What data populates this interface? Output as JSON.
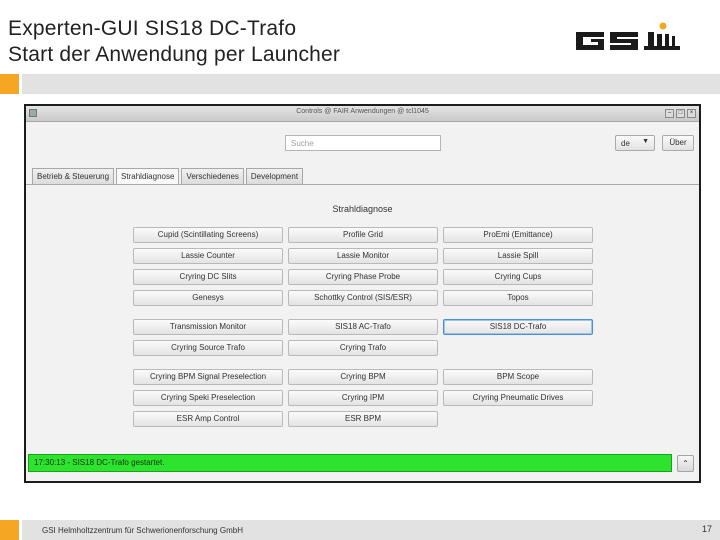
{
  "slide": {
    "title_line1": "Experten-GUI SIS18 DC-Trafo",
    "title_line2": "Start der Anwendung per Launcher",
    "footer": "GSI Helmholtzzentrum für Schwerionenforschung GmbH",
    "page_number": "17",
    "accent_color": "#f5a623"
  },
  "window": {
    "title": "Controls @ FAIR Anwendungen @ tcl1045",
    "controls": [
      "minimize-icon",
      "maximize-icon",
      "close-icon"
    ],
    "search_placeholder": "Suche",
    "language": "de",
    "about_label": "Über",
    "tabs": [
      {
        "label": "Betrieb & Steuerung",
        "active": false
      },
      {
        "label": "Strahldiagnose",
        "active": true
      },
      {
        "label": "Verschiedenes",
        "active": false
      },
      {
        "label": "Development",
        "active": false
      }
    ],
    "section_title": "Strahldiagnose",
    "buttons": [
      "Cupid (Scintillating Screens)",
      "Profile Grid",
      "ProEmi (Emittance)",
      "Lassie Counter",
      "Lassie Monitor",
      "Lassie Spill",
      "Cryring DC Slits",
      "Cryring Phase Probe",
      "Cryring Cups",
      "Genesys",
      "Schottky Control (SIS/ESR)",
      "Topos",
      "Transmission Monitor",
      "SIS18 AC-Trafo",
      "SIS18 DC-Trafo",
      "Cryring Source Trafo",
      "Cryring Trafo",
      "Cryring BPM Signal Preselection",
      "Cryring BPM",
      "BPM Scope",
      "Cryring Speki Preselection",
      "Cryring IPM",
      "Cryring Pneumatic Drives",
      "ESR Amp Control",
      "ESR BPM"
    ],
    "focused_button": "SIS18 DC-Trafo",
    "status_message": "17:30:13 - SIS18 DC-Trafo gestartet.",
    "status_color": "#2ee32e"
  }
}
